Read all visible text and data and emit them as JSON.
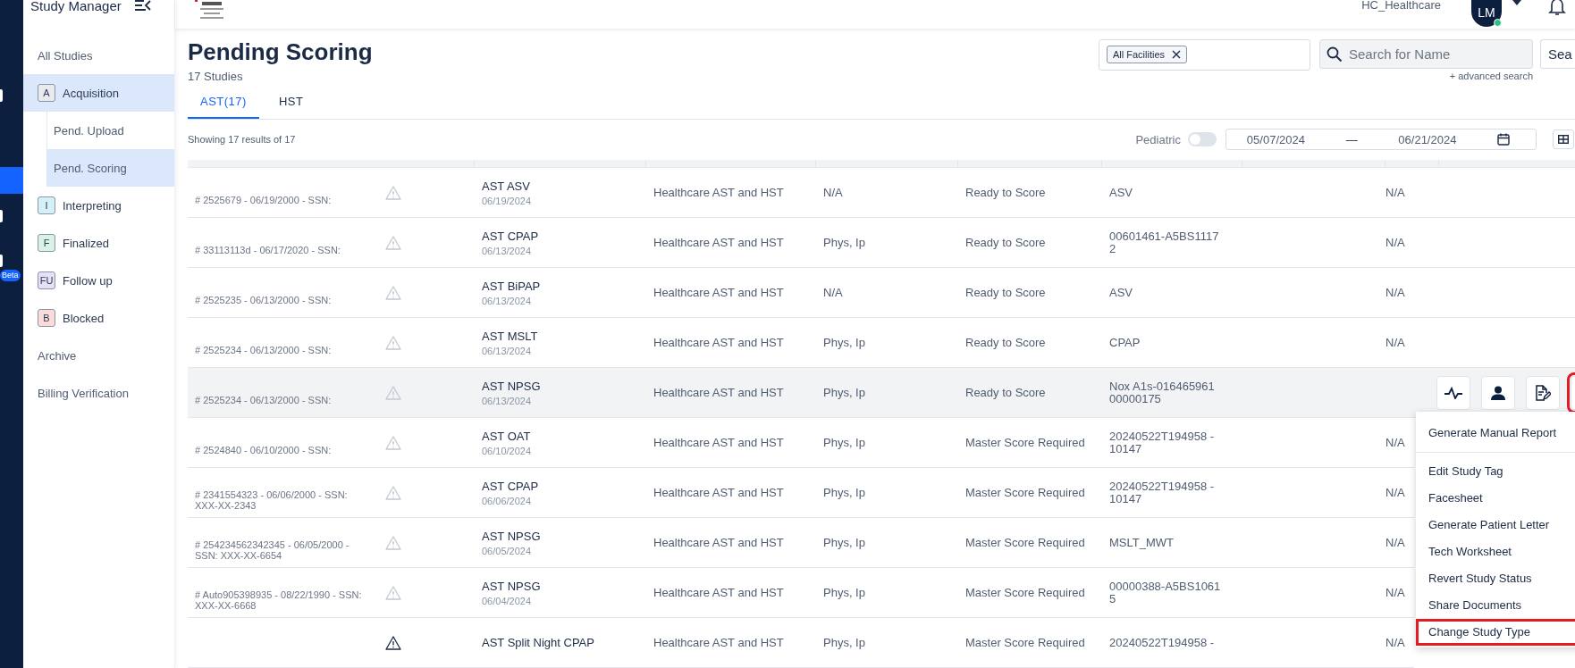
{
  "app": {
    "title": "Study Manager",
    "beta_badge": "Beta"
  },
  "header": {
    "user": "HC_Healthcare",
    "avatar": "LM",
    "online": true
  },
  "sidebar": {
    "items": [
      {
        "label": "All Studies",
        "kind": "link",
        "selected": false
      },
      {
        "label": "Acquisition",
        "kind": "group",
        "badge": "A",
        "color": "#e8eaee",
        "selected": true
      },
      {
        "label": "Pend. Upload",
        "kind": "sub",
        "selected": false
      },
      {
        "label": "Pend. Scoring",
        "kind": "sub",
        "selected": true
      },
      {
        "label": "Interpreting",
        "kind": "group",
        "badge": "I",
        "color": "#d4f1f7",
        "selected": false
      },
      {
        "label": "Finalized",
        "kind": "group",
        "badge": "F",
        "color": "#d9f2e6",
        "selected": false
      },
      {
        "label": "Follow up",
        "kind": "group",
        "badge": "FU",
        "color": "#e6e0f7",
        "selected": false
      },
      {
        "label": "Blocked",
        "kind": "group",
        "badge": "B",
        "color": "#f9dcd8",
        "selected": false
      },
      {
        "label": "Archive",
        "kind": "link",
        "selected": false
      },
      {
        "label": "Billing Verification",
        "kind": "link",
        "selected": false
      }
    ]
  },
  "page": {
    "title": "Pending Scoring",
    "count": "17 Studies",
    "showing": "Showing 17 results of 17"
  },
  "tabs": [
    {
      "label": "AST(17)",
      "selected": true
    },
    {
      "label": "HST",
      "selected": false
    }
  ],
  "filters": {
    "facility_chip": "All Facilities",
    "search_placeholder": "Search for Name",
    "search_button": "Sea",
    "advanced": "+ advanced search",
    "pediatric_label": "Pediatric",
    "pediatric_on": false,
    "date_from": "05/07/2024",
    "date_separator": "—",
    "date_to": "06/21/2024"
  },
  "table": {
    "rows": [
      {
        "patient": "# 2525679 - 06/19/2000 - SSN:",
        "study": "AST ASV",
        "date": "06/19/2024",
        "facility": "Healthcare AST and HST",
        "physician": "N/A",
        "status": "Ready to Score",
        "device": "ASV",
        "column_8": "N/A",
        "highlighted": false
      },
      {
        "patient": "# 33113113d - 06/17/2020 - SSN:",
        "study": "AST CPAP",
        "date": "06/13/2024",
        "facility": "Healthcare AST and HST",
        "physician": "Phys, Ip",
        "status": "Ready to Score",
        "device": "00601461-A5BS11172",
        "column_8": "N/A",
        "highlighted": false
      },
      {
        "patient": "# 2525235 - 06/13/2000 - SSN:",
        "study": "AST BiPAP",
        "date": "06/13/2024",
        "facility": "Healthcare AST and HST",
        "physician": "N/A",
        "status": "Ready to Score",
        "device": "ASV",
        "column_8": "N/A",
        "highlighted": false
      },
      {
        "patient": "# 2525234 - 06/13/2000 - SSN:",
        "study": "AST MSLT",
        "date": "06/13/2024",
        "facility": "Healthcare AST and HST",
        "physician": "Phys, Ip",
        "status": "Ready to Score",
        "device": "CPAP",
        "column_8": "N/A",
        "highlighted": false
      },
      {
        "patient": "# 2525234 - 06/13/2000 - SSN:",
        "study": "AST NPSG",
        "date": "06/13/2024",
        "facility": "Healthcare AST and HST",
        "physician": "Phys, Ip",
        "status": "Ready to Score",
        "device": "Nox A1s-01646596100000175",
        "highlighted": true
      },
      {
        "patient": "# 2524840 - 06/10/2000 - SSN:",
        "study": "AST OAT",
        "date": "06/10/2024",
        "facility": "Healthcare AST and HST",
        "physician": "Phys, Ip",
        "status": "Master Score Required",
        "device": "20240522T194958 - 10147",
        "column_8": "N/A",
        "highlighted": false
      },
      {
        "patient": "# 2341554323 - 06/06/2000 - SSN: XXX-XX-2343",
        "study": "AST CPAP",
        "date": "06/06/2024",
        "facility": "Healthcare AST and HST",
        "physician": "Phys, Ip",
        "status": "Master Score Required",
        "device": "20240522T194958 - 10147",
        "column_8": "N/A",
        "highlighted": false
      },
      {
        "patient": "# 254234562342345 - 06/05/2000 - SSN: XXX-XX-6654",
        "study": "AST NPSG",
        "date": "06/05/2024",
        "facility": "Healthcare AST and HST",
        "physician": "Phys, Ip",
        "status": "Master Score Required",
        "device": "MSLT_MWT",
        "column_8": "N/A",
        "highlighted": false
      },
      {
        "patient": "# Auto905398935 - 08/22/1990 - SSN: XXX-XX-6668",
        "study": "AST NPSG",
        "date": "06/04/2024",
        "facility": "Healthcare AST and HST",
        "physician": "Phys, Ip",
        "status": "Master Score Required",
        "device": "00000388-A5BS10615",
        "column_8": "N/A",
        "highlighted": false
      },
      {
        "study": "AST Split Night CPAP",
        "facility": "Healthcare AST and HST",
        "physician": "Phys, Ip",
        "status": "Master Score Required",
        "device": "20240522T194958 -",
        "column_8": "N/A",
        "highlighted": false
      }
    ]
  },
  "row_menu": {
    "items": [
      {
        "label": "Generate Manual Report",
        "highlighted": false
      },
      {
        "label": "Edit Study Tag",
        "highlighted": false
      },
      {
        "label": "Facesheet",
        "highlighted": false
      },
      {
        "label": "Generate Patient Letter",
        "highlighted": false
      },
      {
        "label": "Tech Worksheet",
        "highlighted": false
      },
      {
        "label": "Revert Study Status",
        "highlighted": false
      },
      {
        "label": "Share Documents",
        "highlighted": false
      },
      {
        "label": "Change Study Type",
        "highlighted": true
      }
    ]
  }
}
